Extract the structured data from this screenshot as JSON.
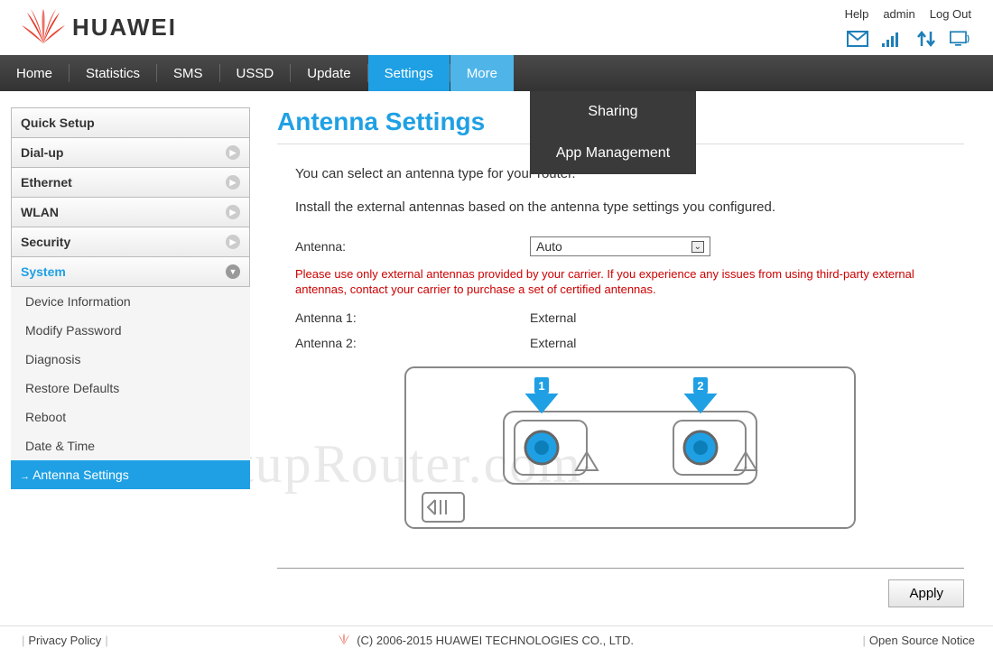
{
  "brand": "HUAWEI",
  "top_links": {
    "help": "Help",
    "admin": "admin",
    "logout": "Log Out"
  },
  "nav": [
    "Home",
    "Statistics",
    "SMS",
    "USSD",
    "Update",
    "Settings",
    "More"
  ],
  "dropdown": {
    "sharing": "Sharing",
    "app_mgmt": "App Management"
  },
  "sidebar": {
    "quick_setup": "Quick Setup",
    "dialup": "Dial-up",
    "ethernet": "Ethernet",
    "wlan": "WLAN",
    "security": "Security",
    "system": "System",
    "subs": {
      "device_info": "Device Information",
      "modify_pw": "Modify Password",
      "diagnosis": "Diagnosis",
      "restore": "Restore Defaults",
      "reboot": "Reboot",
      "datetime": "Date & Time",
      "antenna": "Antenna Settings"
    }
  },
  "page": {
    "title": "Antenna Settings",
    "intro1": "You can select an antenna type for your router.",
    "intro2": "Install the external antennas based on the antenna type settings you configured.",
    "antenna_label": "Antenna:",
    "antenna_value": "Auto",
    "warning": "Please use only external antennas provided by your carrier. If you experience any issues from using third-party external antennas, contact your carrier to purchase a set of certified antennas.",
    "ant1_label": "Antenna 1:",
    "ant1_value": "External",
    "ant2_label": "Antenna 2:",
    "ant2_value": "External",
    "apply": "Apply"
  },
  "diagram": {
    "badge1": "1",
    "badge2": "2"
  },
  "footer": {
    "privacy": "Privacy Policy",
    "copyright": "(C) 2006-2015 HUAWEI TECHNOLOGIES CO., LTD.",
    "oss": "Open Source Notice"
  },
  "watermark": "SetupRouter.com"
}
